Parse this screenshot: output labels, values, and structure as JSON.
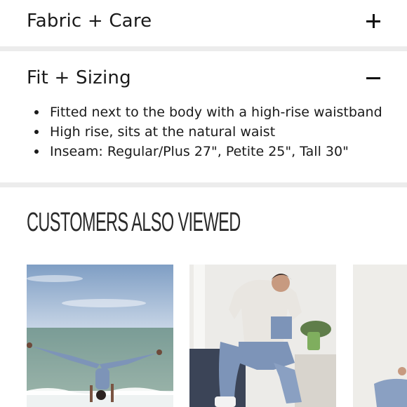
{
  "accordions": [
    {
      "title": "Fabric + Care",
      "toggle": "plus-icon"
    },
    {
      "title": "Fit + Sizing",
      "toggle": "minus-icon"
    }
  ],
  "fit_details": [
    "Fitted next to the body with a high-rise waistband",
    "High rise, sits at the natural waist",
    "Inseam: Regular/Plus 27\", Petite 25\", Tall 30\""
  ],
  "customers_also_viewed": {
    "heading": "CUSTOMERS ALSO VIEWED",
    "products": [
      {
        "image": "woman-handstand-beach-photo"
      },
      {
        "image": "woman-seated-jacket-photo"
      },
      {
        "image": "partial-product-photo"
      }
    ]
  },
  "colors": {
    "divider": "#ececec",
    "text": "#1a1a1a",
    "legging_blue": "#7d94b8"
  }
}
